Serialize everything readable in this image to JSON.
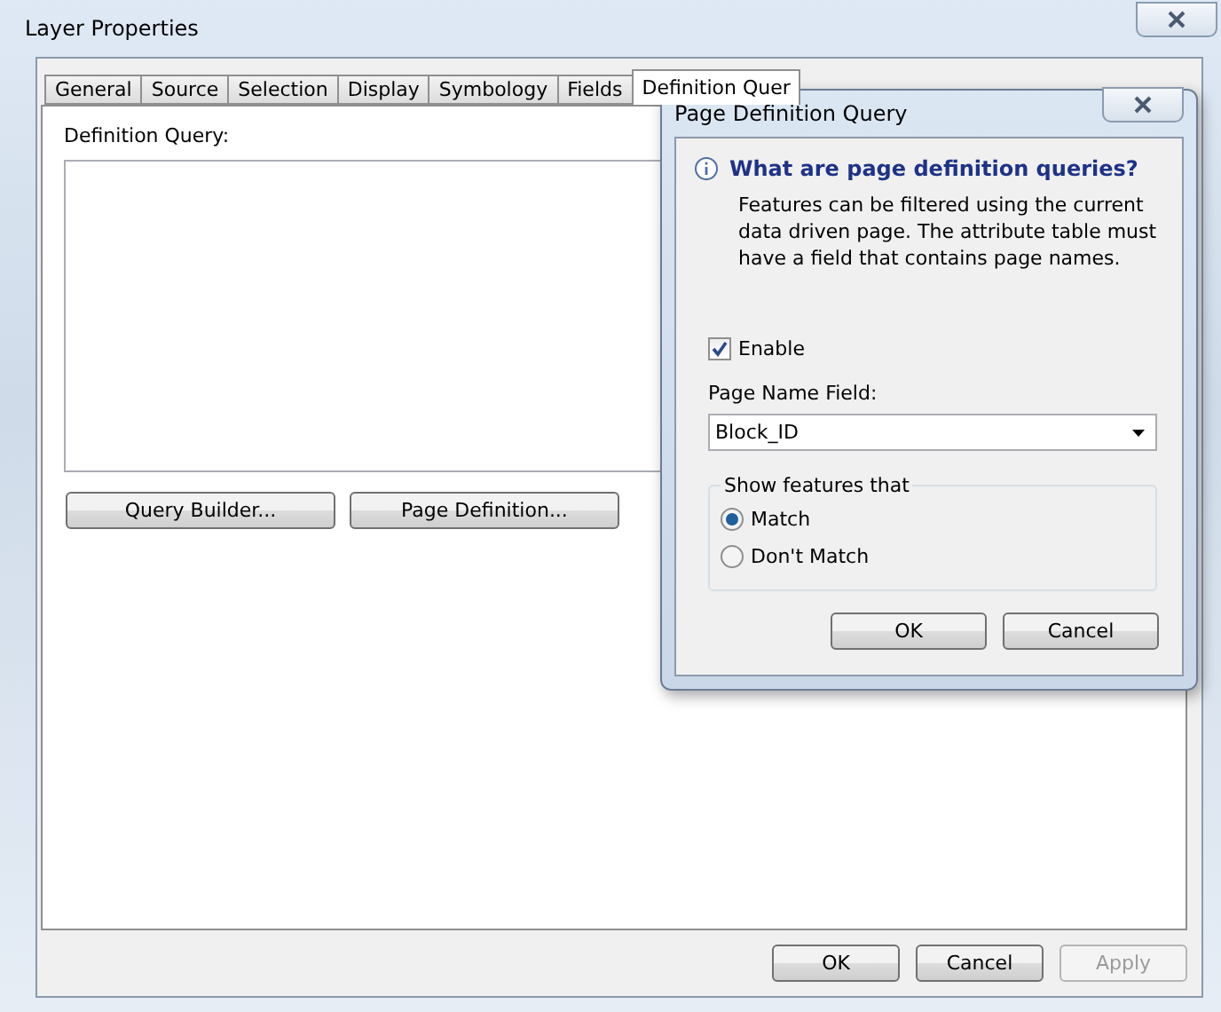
{
  "window": {
    "title": "Layer Properties"
  },
  "tabs": [
    {
      "label": "General",
      "selected": false
    },
    {
      "label": "Source",
      "selected": false
    },
    {
      "label": "Selection",
      "selected": false
    },
    {
      "label": "Display",
      "selected": false
    },
    {
      "label": "Symbology",
      "selected": false
    },
    {
      "label": "Fields",
      "selected": false
    },
    {
      "label": "Definition Quer",
      "selected": true
    }
  ],
  "definition_query": {
    "label": "Definition Query:",
    "buttons": [
      "Query Builder...",
      "Page Definition..."
    ]
  },
  "footer_buttons": [
    {
      "label": "OK",
      "disabled": false
    },
    {
      "label": "Cancel",
      "disabled": false
    },
    {
      "label": "Apply",
      "disabled": true
    }
  ],
  "dialog": {
    "title": "Page Definition Query",
    "heading": "What are page definition queries?",
    "description": "Features can be filtered using the current data driven page.  The attribute table must have a field that contains page names.",
    "enable": {
      "label": "Enable",
      "checked": true
    },
    "page_name_field": {
      "label": "Page Name Field:",
      "value": "Block_ID"
    },
    "show_features": {
      "legend": "Show features that",
      "options": [
        {
          "label": "Match",
          "selected": true
        },
        {
          "label": "Don't Match",
          "selected": false
        }
      ]
    },
    "buttons": [
      "OK",
      "Cancel"
    ]
  }
}
